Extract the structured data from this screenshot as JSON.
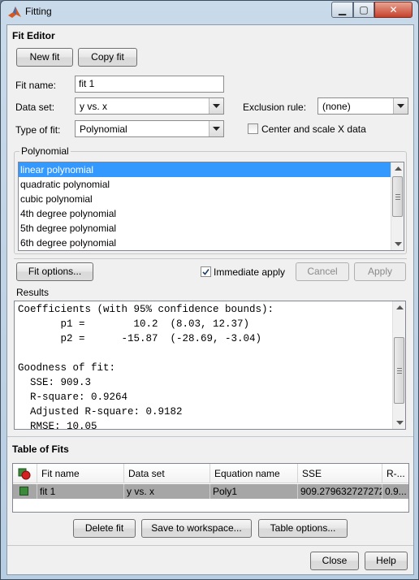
{
  "window": {
    "title": "Fitting",
    "min_glyph": "▁",
    "max_glyph": "▢",
    "close_glyph": "✕"
  },
  "fit_editor": {
    "heading": "Fit Editor",
    "new_fit_label": "New fit",
    "copy_fit_label": "Copy fit",
    "fit_name_label": "Fit name:",
    "fit_name_value": "fit 1",
    "data_set_label": "Data set:",
    "data_set_value": "y vs. x",
    "exclusion_rule_label": "Exclusion rule:",
    "exclusion_rule_value": "(none)",
    "type_of_fit_label": "Type of fit:",
    "type_of_fit_value": "Polynomial",
    "center_scale_label": "Center and scale X data",
    "center_scale_checked": false
  },
  "polynomial": {
    "legend": "Polynomial",
    "items": [
      {
        "label": "linear polynomial",
        "selected": true
      },
      {
        "label": "quadratic polynomial",
        "selected": false
      },
      {
        "label": "cubic polynomial",
        "selected": false
      },
      {
        "label": "4th degree polynomial",
        "selected": false
      },
      {
        "label": "5th degree polynomial",
        "selected": false
      },
      {
        "label": "6th degree polynomial",
        "selected": false
      }
    ]
  },
  "actions": {
    "fit_options_label": "Fit options...",
    "immediate_apply_label": "Immediate apply",
    "immediate_apply_checked": true,
    "cancel_label": "Cancel",
    "apply_label": "Apply"
  },
  "results": {
    "heading": "Results",
    "lines": [
      "Coefficients (with 95% confidence bounds):",
      "       p1 =        10.2  (8.03, 12.37)",
      "       p2 =      -15.87  (-28.69, -3.04)",
      "",
      "Goodness of fit:",
      "  SSE: 909.3",
      "  R-square: 0.9264",
      "  Adjusted R-square: 0.9182",
      "  RMSE: 10.05"
    ]
  },
  "table_of_fits": {
    "heading": "Table of Fits",
    "columns": [
      "",
      "Fit name",
      "Data set",
      "Equation name",
      "SSE",
      "R-..."
    ],
    "rows": [
      {
        "fit_name": "fit 1",
        "data_set": "y vs. x",
        "equation_name": "Poly1",
        "sse": "909.2796327272722",
        "r_square": "0.9..."
      }
    ]
  },
  "bottom_buttons": {
    "delete_fit_label": "Delete fit",
    "save_to_workspace_label": "Save to workspace...",
    "table_options_label": "Table options..."
  },
  "footer": {
    "close_label": "Close",
    "help_label": "Help"
  },
  "colors": {
    "selection": "#3399ff",
    "row_highlight": "#a6a6a6",
    "close_button": "#c7412c"
  }
}
